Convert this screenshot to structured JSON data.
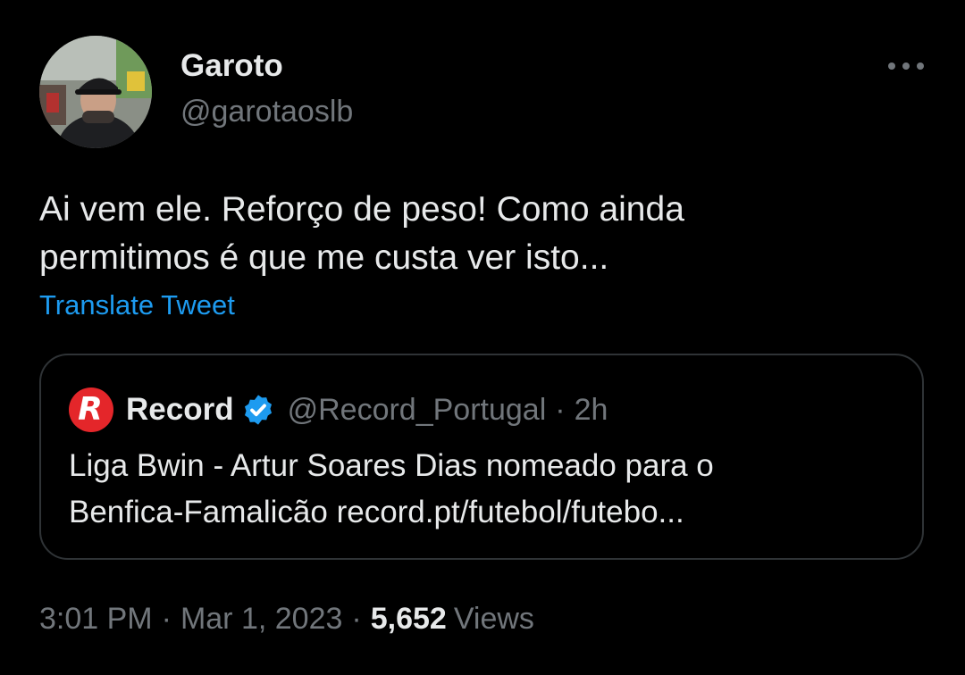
{
  "author": {
    "name": "Garoto",
    "handle": "@garotaoslb",
    "avatar_icon": "user-avatar-photo"
  },
  "more_icon": "more-horizontal-icon",
  "tweet": {
    "lines": [
      "Ai vem ele. Reforço de peso! Como ainda",
      "permitimos é que me custa ver isto..."
    ],
    "translate_label": "Translate Tweet"
  },
  "quote": {
    "logo_letter": "R",
    "name": "Record",
    "verified_icon": "verified-badge-icon",
    "handle": "@Record_Portugal",
    "separator": "·",
    "time": "2h",
    "lines": [
      "Liga Bwin - Artur Soares Dias nomeado para o",
      "Benfica-Famalicão record.pt/futebol/futebo..."
    ]
  },
  "meta": {
    "time": "3:01 PM",
    "separator": "·",
    "date": "Mar 1, 2023",
    "views_count": "5,652",
    "views_label": "Views"
  },
  "colors": {
    "background": "#000000",
    "text_primary": "#e7e9ea",
    "text_secondary": "#71767b",
    "accent": "#1d9bf0",
    "border": "#2f3336",
    "record_brand": "#e4262a"
  }
}
